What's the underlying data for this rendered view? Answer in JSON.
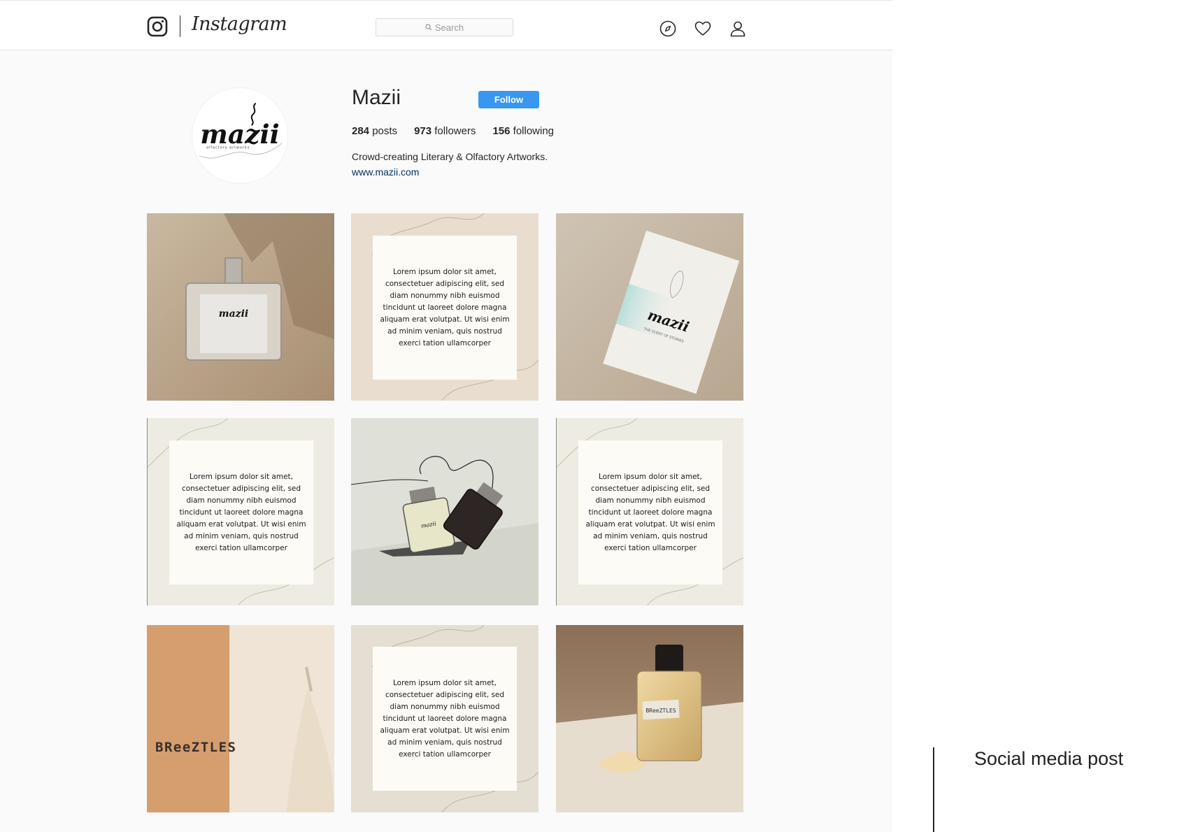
{
  "nav": {
    "wordmark": "Instagram",
    "search_placeholder": "Search"
  },
  "profile": {
    "username": "Mazii",
    "follow_label": "Follow",
    "posts_count": "284",
    "posts_label": "posts",
    "followers_count": "973",
    "followers_label": "followers",
    "following_count": "156",
    "following_label": "following",
    "bio": "Crowd-creating Literary & Olfactory Artworks.",
    "website": "www.mazii.com",
    "avatar_logo_text": "mazii",
    "avatar_tagline": "olfactory artworks"
  },
  "posts": {
    "lorem": "Lorem ipsum dolor sit amet, consectetuer adipiscing elit, sed diam nonummy nibh euismod tincidunt ut laoreet dolore magna aliquam erat volutpat. Ut wisi enim ad minim veniam, quis nostrud exerci tation ullamcorper",
    "breeztles_text": "BReeZTLES",
    "bottle_label": "mazii",
    "card_subtitle": "THE SCENT OF STORIES"
  },
  "caption": "Social media post",
  "colors": {
    "follow_blue": "#3897f0",
    "link_navy": "#003569",
    "beige_bg": "#e9ddd0",
    "cream_bg": "#eeece2",
    "terracotta": "#d49e6f"
  }
}
